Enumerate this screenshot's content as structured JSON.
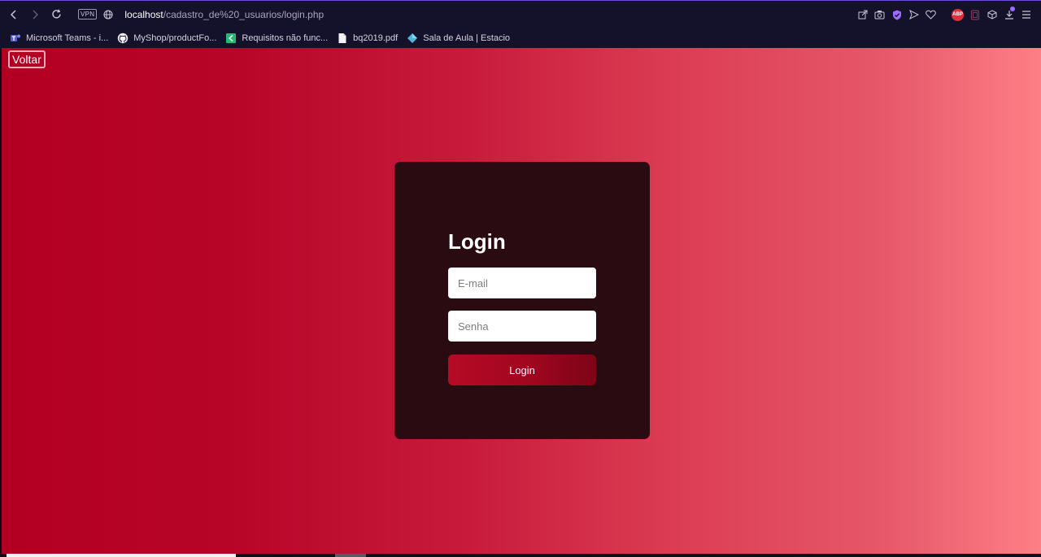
{
  "browser": {
    "url_host": "localhost",
    "url_path": "/cadastro_de%20_usuarios/login.php",
    "vpn_badge": "VPN",
    "adblock_badge": "ABP"
  },
  "bookmarks": [
    {
      "label": "Microsoft Teams - i...",
      "icon": "teams-icon"
    },
    {
      "label": "MyShop/productFo...",
      "icon": "github-icon"
    },
    {
      "label": "Requisitos não func...",
      "icon": "spreadsheet-icon"
    },
    {
      "label": "bq2019.pdf",
      "icon": "file-icon"
    },
    {
      "label": "Sala de Aula | Estacio",
      "icon": "diamond-icon"
    }
  ],
  "page": {
    "back_label": "Voltar",
    "login_title": "Login",
    "email_placeholder": "E-mail",
    "password_placeholder": "Senha",
    "submit_label": "Login"
  },
  "colors": {
    "gradient_start": "#b30022",
    "gradient_end": "#fe7f86",
    "card_bg": "#2a0b11",
    "button": "#a00620"
  }
}
